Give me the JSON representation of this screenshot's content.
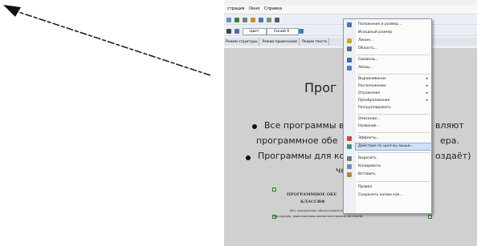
{
  "menubar": {
    "items": [
      "страция",
      "Окно",
      "Справка"
    ]
  },
  "toolbar": {
    "color_label": "Цвет",
    "style_label": "Синий 9"
  },
  "tabs": [
    "Режим структуры",
    "Режим примечаний",
    "Режим тексто"
  ],
  "slide": {
    "title": "Прог",
    "bullet1_line1": "Все программы в",
    "bullet1_line1_tail": "вляют",
    "bullet1_line2": "программное обе",
    "bullet1_line2_tail": "ера.",
    "bullet2_line1": "Программы для ко",
    "bullet2_line1_tail": "оздаёт)",
    "bullet2_line2": "че",
    "thumb_title1": "ПРОГРАММНОЕ ОБЕ",
    "thumb_title2": "КЛАССИФ",
    "thumb_text1": "Все     программы     обеспечивают     ...     совокупность",
    "thumb_text2": "программ, выполняемых вычислительной системой."
  },
  "context_menu": {
    "items": [
      {
        "label": "Положение и размер...",
        "icon": "position-size-icon"
      },
      {
        "label": "Исходный размер",
        "icon": ""
      },
      {
        "label": "Линия...",
        "icon": "line-icon"
      },
      {
        "label": "Область...",
        "icon": "area-icon"
      },
      {
        "label": "Символы...",
        "icon": "symbols-icon"
      },
      {
        "label": "Абзац...",
        "icon": "paragraph-icon"
      },
      {
        "label": "Выравнивание",
        "icon": "",
        "submenu": true
      },
      {
        "label": "Расположение",
        "icon": "",
        "submenu": true
      },
      {
        "label": "Отражение",
        "icon": "",
        "submenu": true
      },
      {
        "label": "Преобразование",
        "icon": "",
        "submenu": true
      },
      {
        "label": "Разгруппировать",
        "icon": ""
      },
      {
        "label": "Описание...",
        "icon": ""
      },
      {
        "label": "Название...",
        "icon": ""
      },
      {
        "label": "Эффекты...",
        "icon": "effects-icon"
      },
      {
        "label": "Действие по щелчку мыши...",
        "icon": "mouse-action-icon"
      },
      {
        "label": "Вырезать",
        "icon": "scissors-icon"
      },
      {
        "label": "Копировать",
        "icon": "copy-icon"
      },
      {
        "label": "Вставить",
        "icon": "paste-icon"
      },
      {
        "label": "Правка",
        "icon": ""
      },
      {
        "label": "Сохранить копию как...",
        "icon": ""
      }
    ]
  }
}
